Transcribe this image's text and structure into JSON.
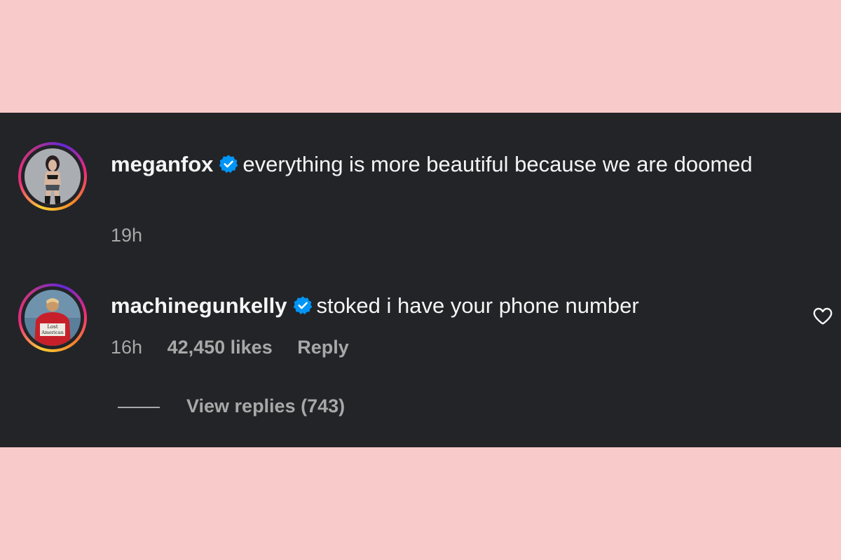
{
  "comments": [
    {
      "username": "meganfox",
      "verified": true,
      "text": "everything is more beautiful because we are doomed",
      "time": "19h"
    },
    {
      "username": "machinegunkelly",
      "verified": true,
      "text": "stoked i have your phone number",
      "time": "16h",
      "likes": "42,450 likes",
      "reply_label": "Reply",
      "avatar_text_line1": "Lost",
      "avatar_text_line2": "American"
    }
  ],
  "view_replies": "View replies (743)",
  "colors": {
    "page_background": "#f8caca",
    "panel_background": "#232428",
    "text_primary": "#f5f5f5",
    "text_secondary": "#a8a8a8",
    "verified_blue": "#0095f6"
  },
  "icons": {
    "verified": "verified-badge-icon",
    "like": "heart-outline-icon"
  }
}
